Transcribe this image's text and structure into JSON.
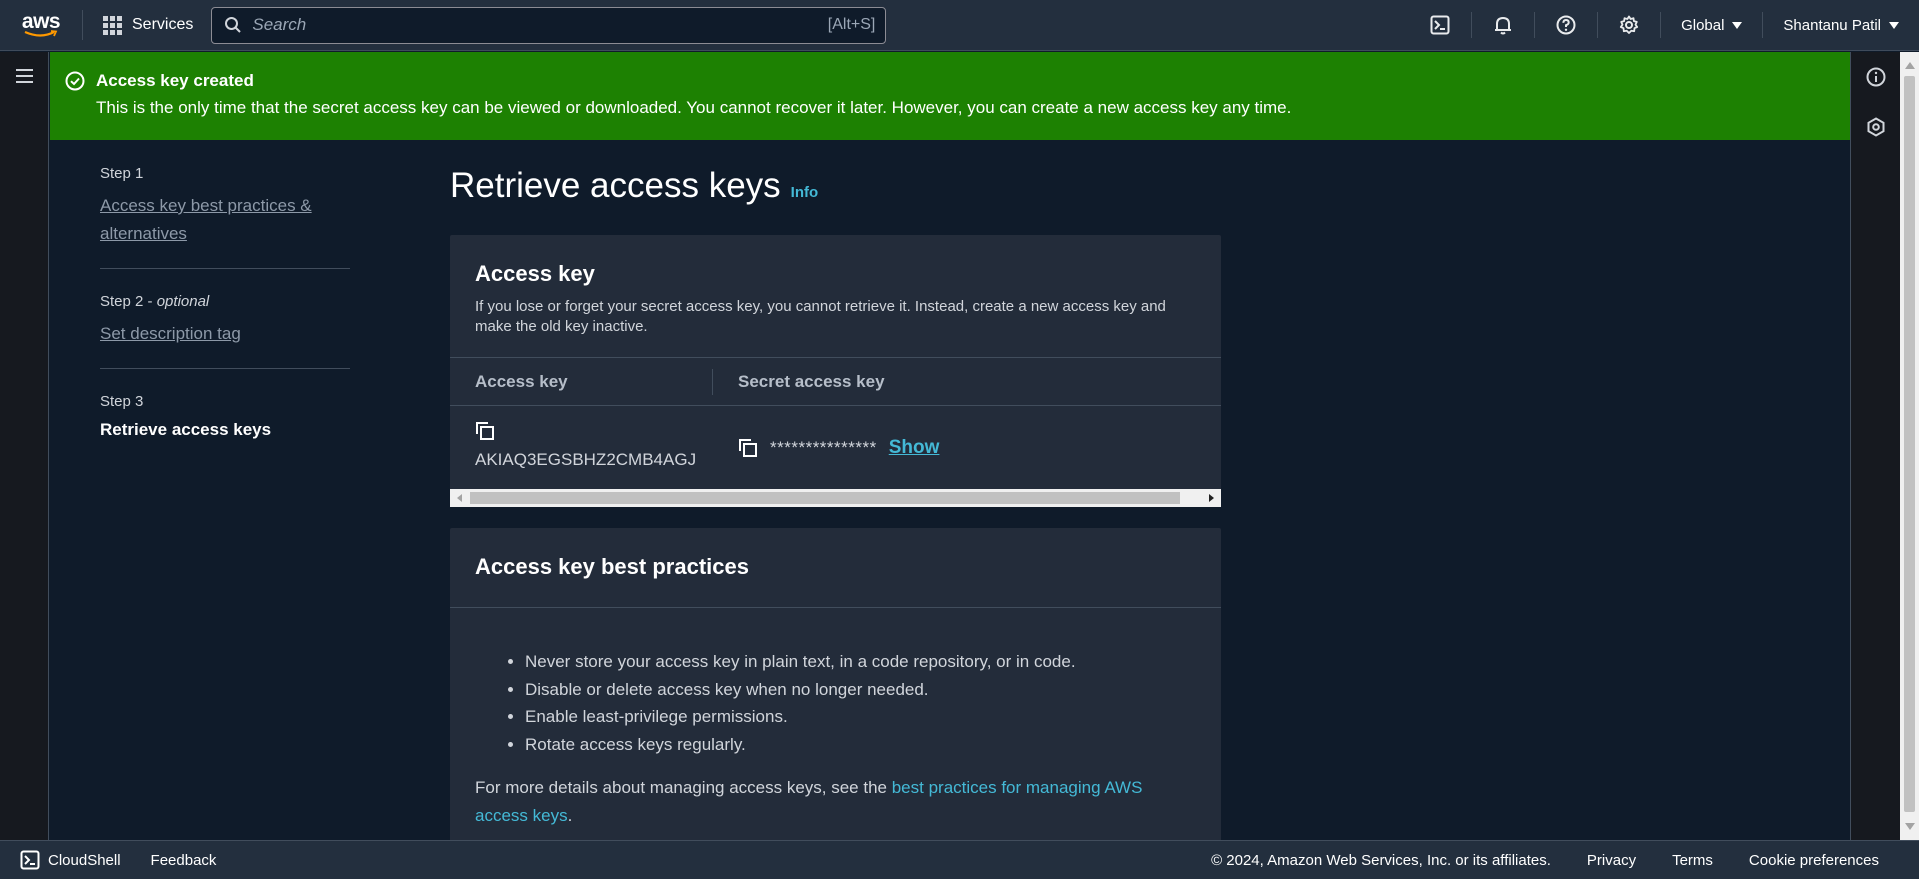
{
  "header": {
    "logo_text": "aws",
    "services_label": "Services",
    "search_placeholder": "Search",
    "search_shortcut": "[Alt+S]",
    "region_label": "Global",
    "user_label": "Shantanu Patil"
  },
  "flash": {
    "title": "Access key created",
    "message": "This is the only time that the secret access key can be viewed or downloaded. You cannot recover it later. However, you can create a new access key any time."
  },
  "steps": [
    {
      "number": "Step 1",
      "label": "Access key best practices & alternatives"
    },
    {
      "number": "Step 2",
      "optional": "optional",
      "label": "Set description tag"
    },
    {
      "number": "Step 3",
      "label": "Retrieve access keys"
    }
  ],
  "page": {
    "title": "Retrieve access keys",
    "info_link": "Info"
  },
  "access_key_card": {
    "title": "Access key",
    "description": "If you lose or forget your secret access key, you cannot retrieve it. Instead, create a new access key and make the old key inactive.",
    "columns": [
      "Access key",
      "Secret access key"
    ],
    "access_key_id": "AKIAQ3EGSBHZ2CMB4AGJ",
    "secret_masked": "***************",
    "show_label": "Show"
  },
  "best_practices_card": {
    "title": "Access key best practices",
    "items": [
      "Never store your access key in plain text, in a code repository, or in code.",
      "Disable or delete access key when no longer needed.",
      "Enable least-privilege permissions.",
      "Rotate access keys regularly."
    ],
    "more_prefix": "For more details about managing access keys, see the ",
    "more_link": "best practices for managing AWS access keys",
    "more_suffix": "."
  },
  "footer": {
    "cloudshell": "CloudShell",
    "feedback": "Feedback",
    "copyright": "© 2024, Amazon Web Services, Inc. or its affiliates.",
    "privacy": "Privacy",
    "terms": "Terms",
    "cookies": "Cookie preferences"
  },
  "colors": {
    "nav_bg": "#232f3e",
    "success_green": "#1d8102",
    "link_blue": "#44b9d6",
    "card_bg": "#232c3a",
    "page_bg": "#0f1b2a"
  }
}
